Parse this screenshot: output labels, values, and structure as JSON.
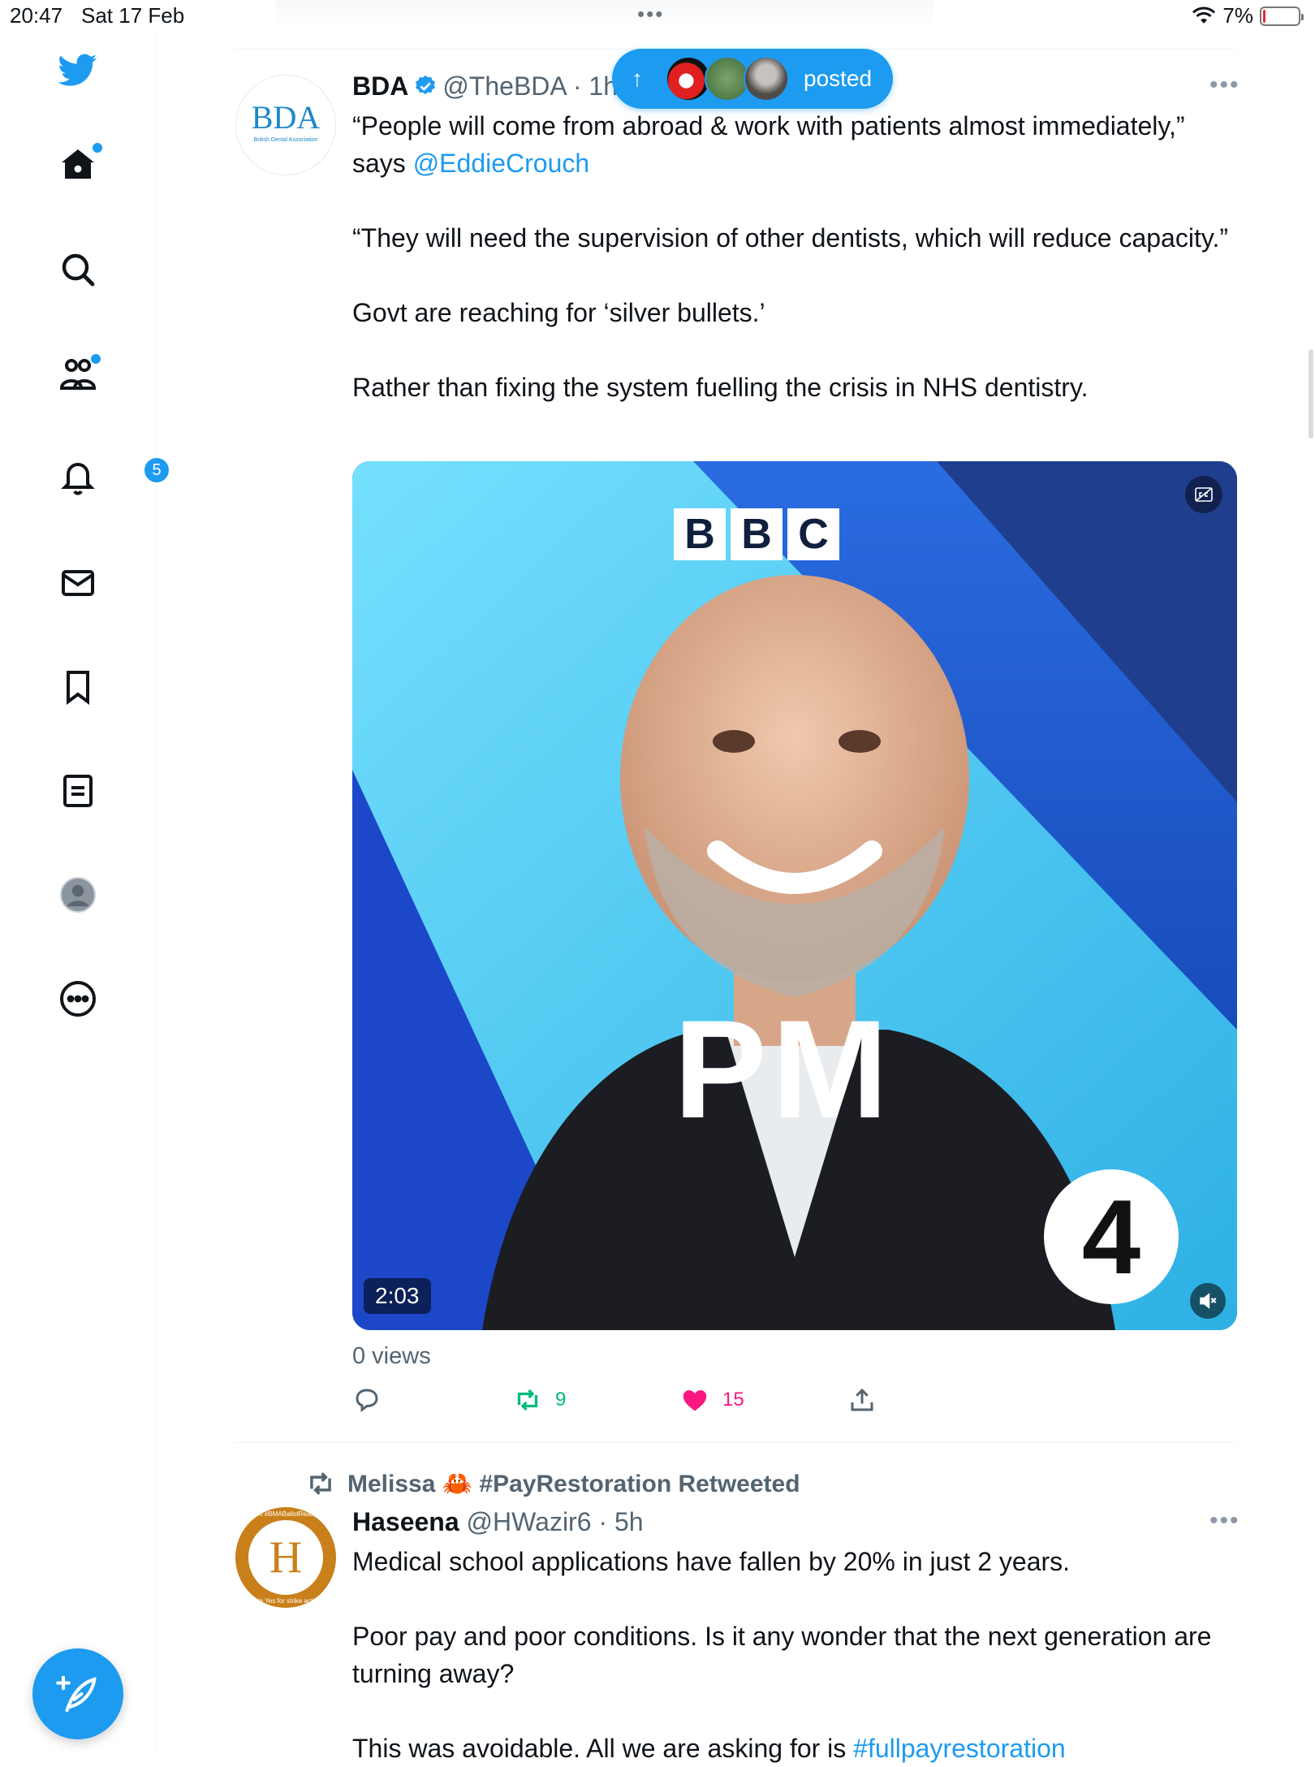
{
  "status_bar": {
    "time": "20:47",
    "date": "Sat 17 Feb",
    "battery_text": "7%",
    "battery_level": 0.07,
    "battery_color": "#e0302f"
  },
  "sidebar": {
    "logo_icon": "twitter-bird-icon",
    "items": [
      {
        "name": "home-icon",
        "has_dot": true
      },
      {
        "name": "search-icon",
        "has_dot": false
      },
      {
        "name": "communities-icon",
        "has_dot": true
      },
      {
        "name": "notifications-icon",
        "badge": "5"
      },
      {
        "name": "messages-icon"
      },
      {
        "name": "bookmarks-icon"
      },
      {
        "name": "lists-icon"
      },
      {
        "name": "profile-avatar-icon"
      },
      {
        "name": "more-options-icon"
      }
    ],
    "compose_icon": "compose-feather-icon"
  },
  "new_posts_pill": {
    "label": "posted",
    "arrow": "↑"
  },
  "tweets": [
    {
      "avatar_text": "BDA",
      "avatar_subtext": "British Dental Association",
      "name": "BDA",
      "handle": "@TheBDA · 1h",
      "text_part1": "“People will come from abroad & work with patients almost immediately,” says ",
      "mention": "@EddieCrouch",
      "text_part2": "\n\n“They will need the supervision of other dentists, which will reduce capacity.”\n\nGovt are reaching for ‘silver bullets.’\n\nRather than fixing the system fuelling the crisis in NHS dentistry.",
      "media": {
        "brand_letters": [
          "B",
          "B",
          "C"
        ],
        "show_title": "PM",
        "channel_number": "4",
        "duration": "2:03"
      },
      "views": "0 views",
      "retweets": "9",
      "likes": "15",
      "accent_retweet": "#00ba7c",
      "accent_like": "#f91880"
    },
    {
      "retweeted_by": "Melissa 🦀 #PayRestoration Retweeted",
      "avatar_letter": "H",
      "avatar_ring_top": "I'm #BMABallotReady",
      "avatar_ring_bottom": "Vote Yes for strike action",
      "name": "Haseena",
      "handle": "@HWazir6 · 5h",
      "text": "Medical school applications have fallen by 20% in just 2 years.\n\nPoor pay and poor conditions. Is it any wonder that the next generation are turning away?\n\nThis was avoidable. All we are asking for is ",
      "hashtag": "#fullpayrestoration"
    }
  ]
}
